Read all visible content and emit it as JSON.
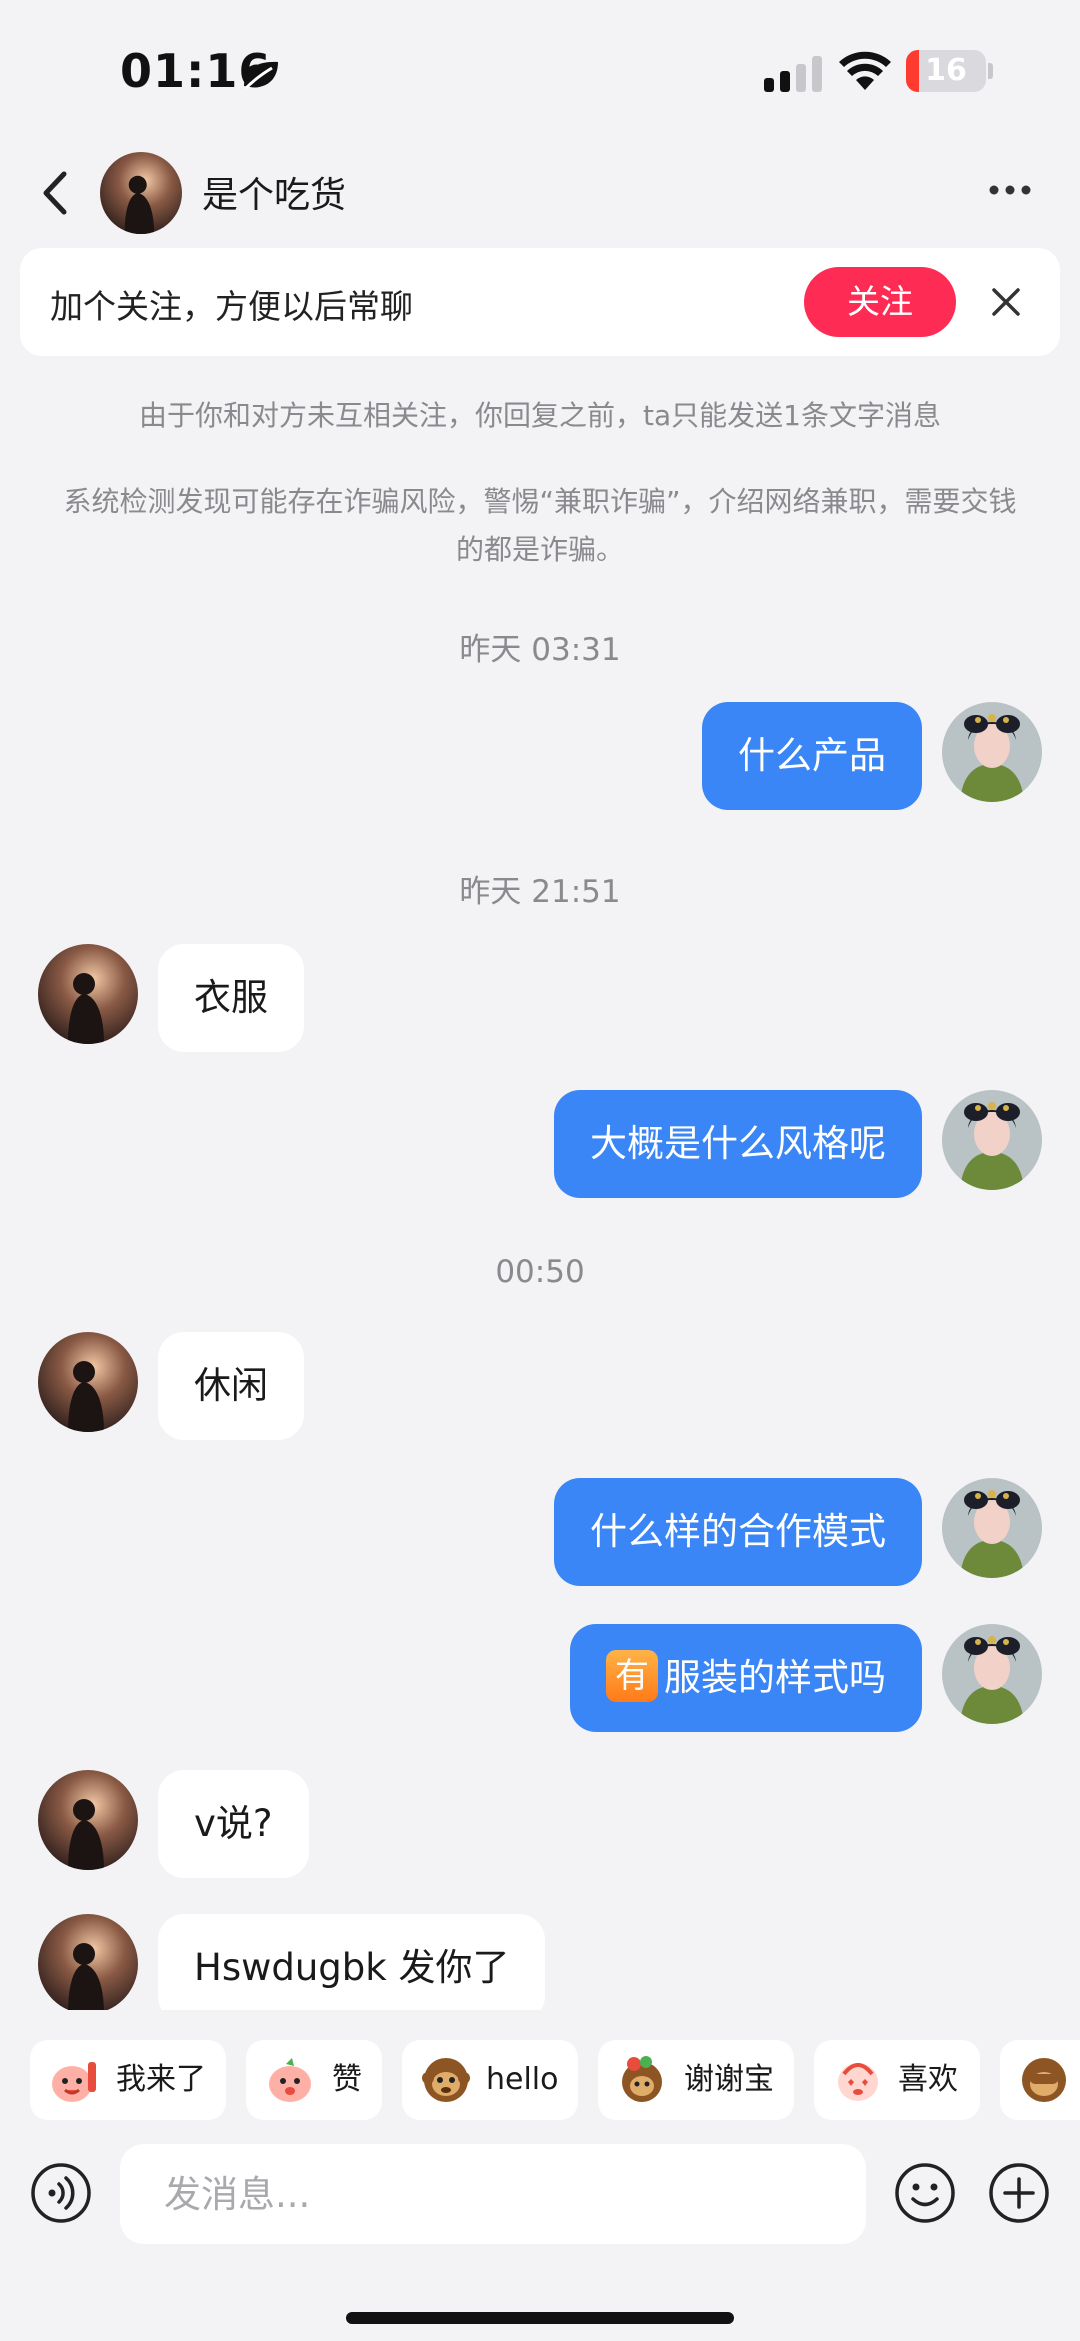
{
  "status_bar": {
    "time": "01:16",
    "battery": "16",
    "battery_level_percent": 16
  },
  "header": {
    "title": "是个吃货"
  },
  "follow_banner": {
    "text": "加个关注，方便以后常聊",
    "button_label": "关注"
  },
  "notices": [
    "由于你和对方未互相关注，你回复之前，ta只能发送1条文字消息",
    "系统检测发现可能存在诈骗风险，警惕“兼职诈骗”，介绍网络兼职，需要交钱的都是诈骗。"
  ],
  "timestamps": [
    "昨天 03:31",
    "昨天 21:51",
    "00:50"
  ],
  "messages": [
    {
      "from": "me",
      "text": "什么产品"
    },
    {
      "from": "them",
      "text": "衣服"
    },
    {
      "from": "me",
      "text": "大概是什么风格呢"
    },
    {
      "from": "them",
      "text": "休闲"
    },
    {
      "from": "me",
      "text": "什么样的合作模式"
    },
    {
      "from": "me",
      "badge": "有",
      "text": "服装的样式吗"
    },
    {
      "from": "them",
      "text": "v说?"
    },
    {
      "from": "them",
      "text": "Hswdugbk 发你了"
    }
  ],
  "quick_replies": [
    {
      "label": "我来了",
      "icon": "sticker-waving-icon"
    },
    {
      "label": "赞",
      "icon": "sticker-thumbs-icon"
    },
    {
      "label": "hello",
      "icon": "monkey-emoji-icon"
    },
    {
      "label": "谢谢宝",
      "icon": "sticker-thanks-icon"
    },
    {
      "label": "喜欢",
      "icon": "sticker-love-icon"
    }
  ],
  "composer": {
    "placeholder": "发消息..."
  },
  "colors": {
    "accent_blue": "#3b86f6",
    "follow_red": "#fe2c55",
    "background": "#f3f3f5"
  }
}
